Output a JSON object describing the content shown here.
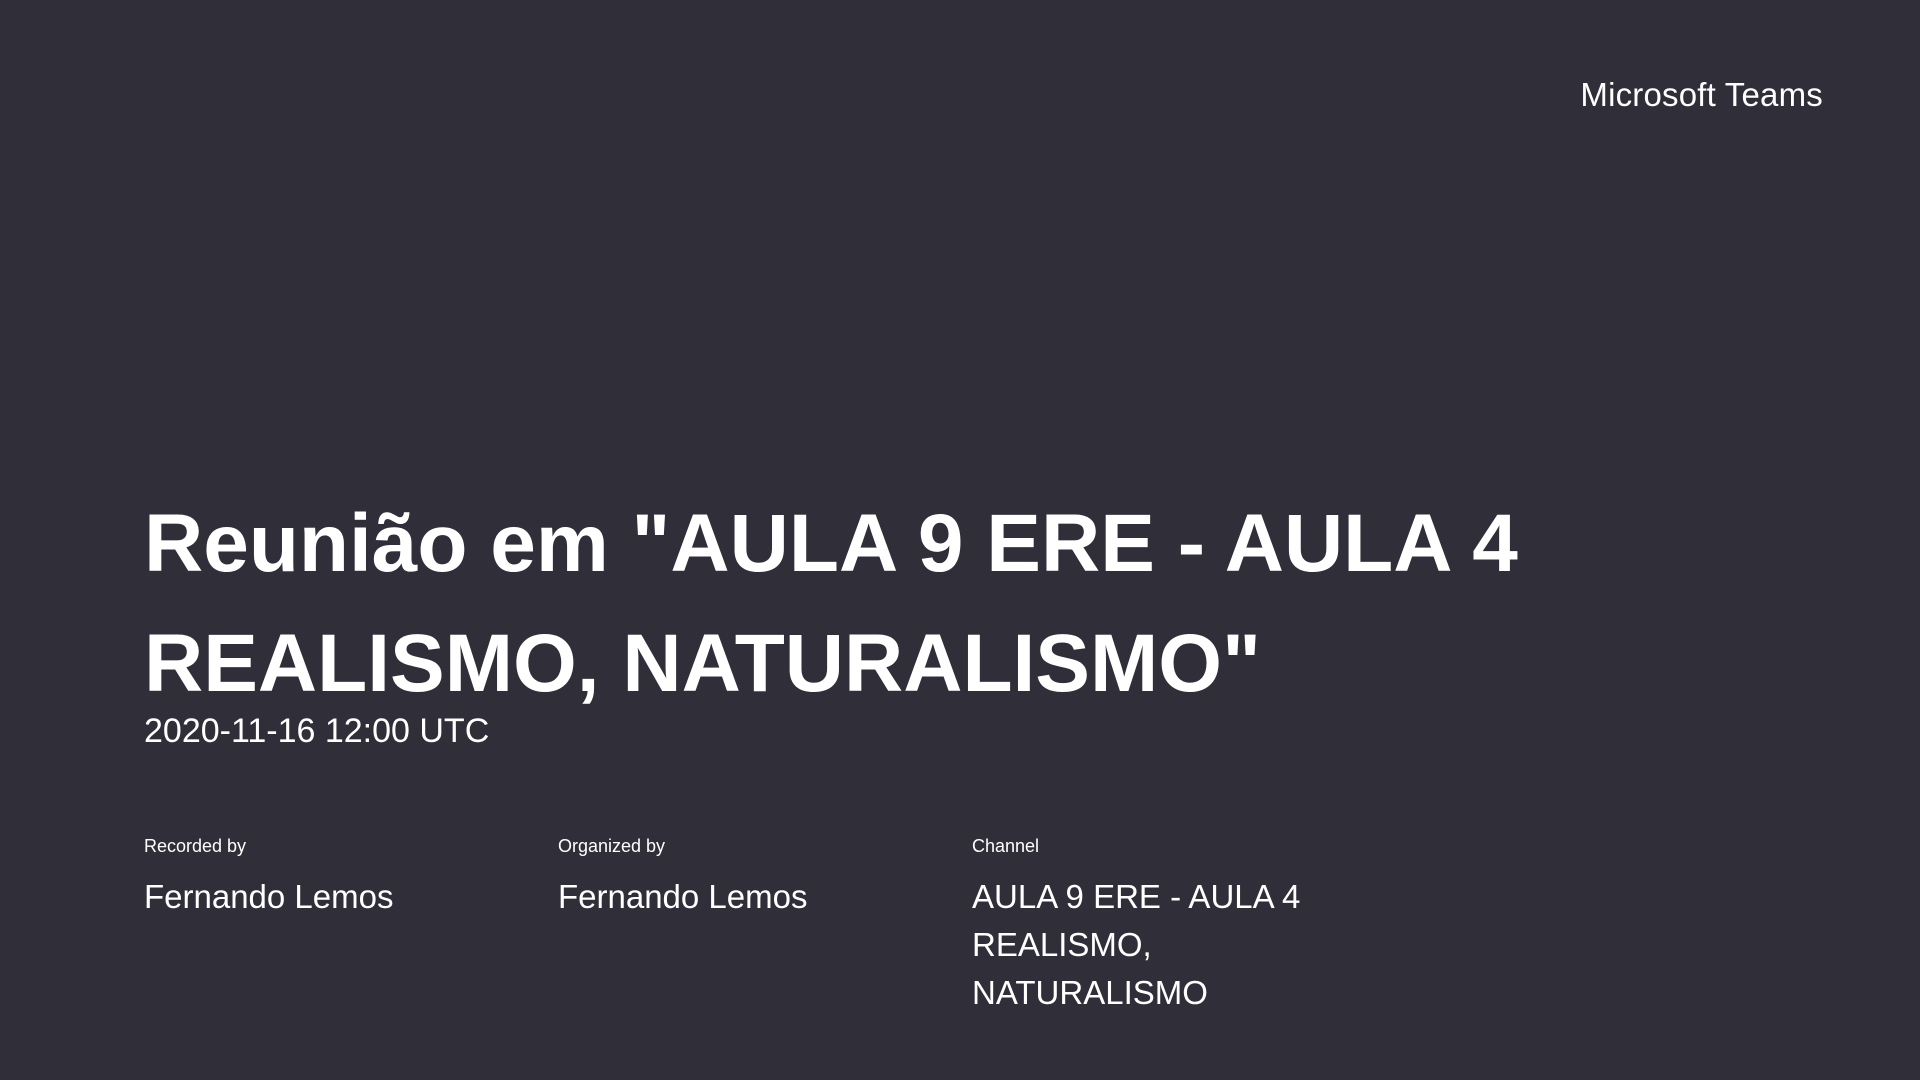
{
  "header": {
    "brand": "Microsoft Teams"
  },
  "meeting": {
    "title": "Reunião em \"AULA 9 ERE - AULA 4 REALISMO, NATURALISMO\"",
    "datetime": "2020-11-16 12:00 UTC"
  },
  "details": {
    "recorded": {
      "label": "Recorded by",
      "value": "Fernando Lemos"
    },
    "organized": {
      "label": "Organized by",
      "value": "Fernando Lemos"
    },
    "channel": {
      "label": "Channel",
      "value": "AULA 9 ERE - AULA 4 REALISMO, NATURALISMO"
    }
  }
}
